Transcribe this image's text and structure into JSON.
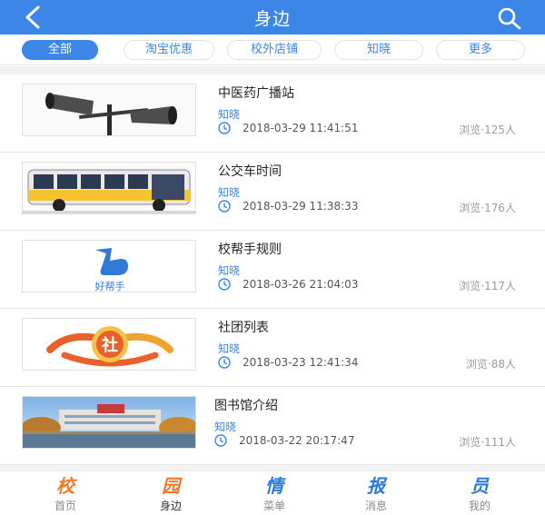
{
  "header": {
    "title": "身边",
    "back_icon": "back-arrow-icon",
    "search_icon": "search-icon"
  },
  "tabs": [
    {
      "label": "全部",
      "active": true
    },
    {
      "label": "淘宝优惠",
      "active": false
    },
    {
      "label": "校外店铺",
      "active": false
    },
    {
      "label": "知晓",
      "active": false
    },
    {
      "label": "更多",
      "active": false
    }
  ],
  "items": [
    {
      "title": "中医药广播站",
      "source": "知晓",
      "date": "2018-03-29 11:41:51",
      "views": "浏览·125人",
      "thumb": "loudspeaker-image"
    },
    {
      "title": "公交车时间",
      "source": "知晓",
      "date": "2018-03-29 11:38:33",
      "views": "浏览·176人",
      "thumb": "bus-image"
    },
    {
      "title": "校帮手规则",
      "source": "知晓",
      "date": "2018-03-26 21:04:03",
      "views": "浏览·117人",
      "thumb": "helper-logo-image",
      "thumb_text": "好帮手"
    },
    {
      "title": "社团列表",
      "source": "知晓",
      "date": "2018-03-23 12:41:34",
      "views": "浏览·88人",
      "thumb": "club-logo-image",
      "thumb_text": "社"
    },
    {
      "title": "图书馆介绍",
      "source": "知晓",
      "date": "2018-03-22 20:17:47",
      "views": "浏览·111人",
      "thumb": "library-image"
    }
  ],
  "tabbar": [
    {
      "label": "首页",
      "glyph": "校",
      "active": false
    },
    {
      "label": "身边",
      "glyph": "园",
      "active": true
    },
    {
      "label": "菜单",
      "glyph": "情",
      "active": false
    },
    {
      "label": "消息",
      "glyph": "报",
      "active": false
    },
    {
      "label": "我的",
      "glyph": "员",
      "active": false
    }
  ],
  "colors": {
    "primary": "#3b86e6",
    "tabbar_orange": "#f07a2a",
    "tabbar_blue": "#2f7ad6"
  }
}
